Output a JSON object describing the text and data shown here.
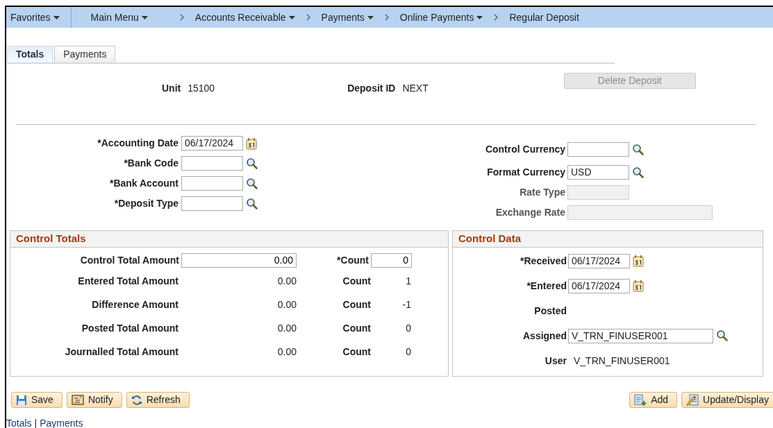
{
  "nav": [
    {
      "label": "Favorites",
      "dropdown": true,
      "kind": "menu"
    },
    {
      "label": "Main Menu",
      "dropdown": true,
      "kind": "menu"
    },
    {
      "label": "Accounts Receivable",
      "dropdown": true,
      "kind": "crumb"
    },
    {
      "label": "Payments",
      "dropdown": true,
      "kind": "crumb"
    },
    {
      "label": "Online Payments",
      "dropdown": true,
      "kind": "crumb"
    },
    {
      "label": "Regular Deposit",
      "dropdown": false,
      "kind": "crumb"
    }
  ],
  "tabs": [
    {
      "label": "Totals",
      "selected": true
    },
    {
      "label": "Payments",
      "selected": false
    }
  ],
  "header": {
    "unit_label": "Unit",
    "unit": "15100",
    "deposit_id_label": "Deposit ID",
    "deposit_id": "NEXT",
    "delete_button": {
      "label": "Delete Deposit",
      "disabled": true
    }
  },
  "left_fields": [
    {
      "label": "*Accounting Date",
      "value": "06/17/2024",
      "kind": "date"
    },
    {
      "label": "*Bank Code",
      "kind": "lookup"
    },
    {
      "label": "*Bank Account",
      "kind": "lookup"
    },
    {
      "label": "*Deposit Type",
      "kind": "lookup"
    }
  ],
  "right_fields": [
    {
      "label": "Control Currency",
      "kind": "lookup"
    },
    {
      "label": "Format Currency",
      "value": "USD",
      "kind": "lookup"
    },
    {
      "label": "Rate Type",
      "kind": "readonly"
    },
    {
      "label": "Exchange Rate",
      "kind": "readonly_wide"
    }
  ],
  "control_totals": {
    "title": "Control Totals",
    "input_row": {
      "label": "Control Total Amount",
      "amount": "0.00",
      "count_label": "*Count",
      "count": "0"
    },
    "rows": [
      {
        "label": "Entered Total Amount",
        "amount": "0.00",
        "count_label": "Count",
        "count": "1"
      },
      {
        "label": "Difference Amount",
        "amount": "0.00",
        "count_label": "Count",
        "count": "-1"
      },
      {
        "label": "Posted Total Amount",
        "amount": "0.00",
        "count_label": "Count",
        "count": "0"
      },
      {
        "label": "Journalled Total Amount",
        "amount": "0.00",
        "count_label": "Count",
        "count": "0"
      }
    ]
  },
  "control_data": {
    "title": "Control Data",
    "fields": [
      {
        "label": "*Received",
        "value": "06/17/2024",
        "kind": "date"
      },
      {
        "label": "*Entered",
        "value": "06/17/2024",
        "kind": "date"
      },
      {
        "label": "Posted",
        "kind": "plain"
      },
      {
        "label": "Assigned",
        "value": "V_TRN_FINUSER001",
        "kind": "lookup_wide"
      },
      {
        "label": "User",
        "value": "V_TRN_FINUSER001",
        "kind": "plain"
      }
    ]
  },
  "left_buttons": [
    {
      "label": "Save",
      "kind": "save"
    },
    {
      "label": "Notify",
      "kind": "notify"
    },
    {
      "label": "Refresh",
      "kind": "refresh"
    }
  ],
  "right_buttons": [
    {
      "label": "Add",
      "kind": "add"
    },
    {
      "label": "Update/Display",
      "kind": "update"
    }
  ],
  "footer_links": [
    {
      "label": "Totals",
      "kind": "link"
    },
    {
      "label": "|",
      "kind": "separator"
    },
    {
      "label": "Payments",
      "kind": "link"
    }
  ]
}
